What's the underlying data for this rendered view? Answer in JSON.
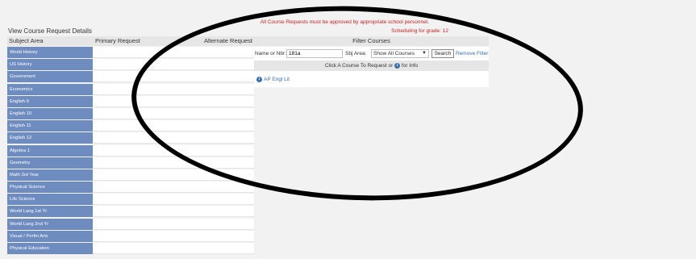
{
  "notices": {
    "approval": "All Course Requests must be approved by appropriate school personnel.",
    "scheduling": "Scheduling for grade: 12"
  },
  "heading": "View Course Request Details",
  "columns": {
    "subject_area": "Subject Area",
    "primary": "Primary Request",
    "alternate": "Alternate Request",
    "filter": "Filter Courses"
  },
  "subjects": [
    "World History",
    "US History",
    "Government",
    "Economics",
    "English 9",
    "English 10",
    "English 11",
    "English 12",
    "Algebra 1",
    "Geometry",
    "Math 3rd Year",
    "Physical Science",
    "Life Science",
    "World Lang 1st Yr",
    "World Lang 2nd Yr",
    "Visual / Perfm Arts",
    "Physical Education"
  ],
  "filter": {
    "name_label": "Name or Nbr:",
    "name_value": "181a",
    "subject_label": "Sbj Area:",
    "subject_value": "Show All Courses",
    "search_button": "Search",
    "remove_filter": "Remove Filter",
    "instruction_prefix": "Click A Course To Request or",
    "instruction_suffix": "for Info",
    "info_glyph": "i"
  },
  "results": [
    {
      "course": "AP Engl Lit"
    }
  ],
  "colors": {
    "subject_bg": "#6e8cbf",
    "notice_red": "#cc1f1f",
    "link_blue": "#3a6fb0"
  }
}
